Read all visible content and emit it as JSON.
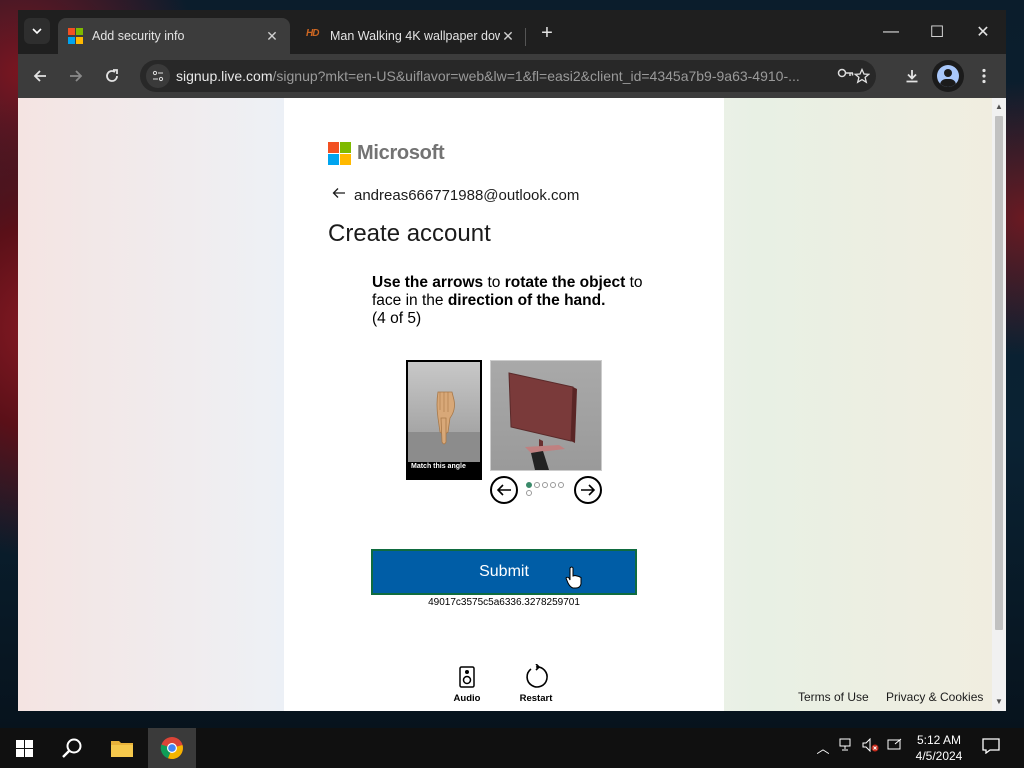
{
  "browser": {
    "tabs": [
      {
        "title": "Add security info",
        "active": true
      },
      {
        "title": "Man Walking 4K wallpaper dow",
        "active": false
      }
    ],
    "url_host": "signup.live.com",
    "url_rest": "/signup?mkt=en-US&uiflavor=web&lw=1&fl=easi2&client_id=4345a7b9-9a63-4910-..."
  },
  "page": {
    "brand": "Microsoft",
    "identity_email": "andreas666771988@outlook.com",
    "heading": "Create account",
    "challenge": {
      "part1_bold": "Use the arrows",
      "part2": " to ",
      "part3_bold": "rotate the object",
      "part4": " to face in the ",
      "part5_bold": "direction of the hand.",
      "progress": "(4 of 5)"
    },
    "reference_caption": "Match this angle",
    "submit_label": "Submit",
    "session_id": "49017c3575c5a6336.3278259701",
    "audio_label": "Audio",
    "restart_label": "Restart",
    "terms_label": "Terms of Use",
    "privacy_label": "Privacy & Cookies"
  },
  "taskbar": {
    "time": "5:12 AM",
    "date": "4/5/2024"
  },
  "colors": {
    "submit_bg": "#005da6",
    "ms_red": "#f25022",
    "ms_green": "#7fba00",
    "ms_blue": "#00a4ef",
    "ms_yellow": "#ffb900"
  },
  "icons": {
    "tab_search": "chevron-down-icon",
    "back": "arrow-left-icon",
    "forward": "arrow-right-icon",
    "reload": "reload-icon",
    "site_info": "tune-icon",
    "password": "key-icon",
    "bookmark": "star-icon",
    "download": "download-icon",
    "menu": "more-vert-icon"
  }
}
